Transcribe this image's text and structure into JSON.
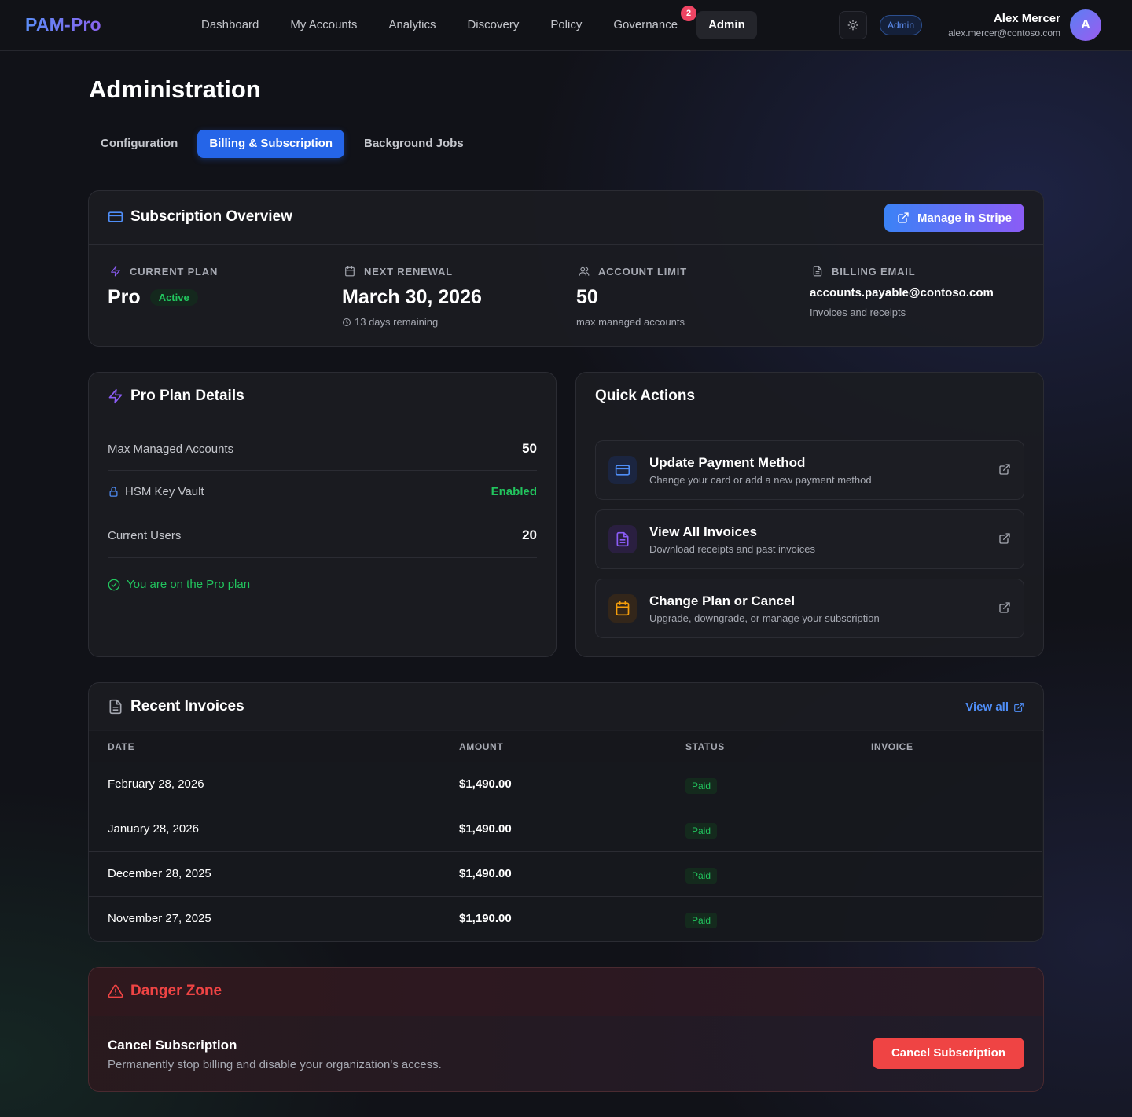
{
  "brand": "PAM-Pro",
  "nav": {
    "items": [
      "Dashboard",
      "My Accounts",
      "Analytics",
      "Discovery",
      "Policy",
      "Governance",
      "Admin"
    ],
    "governance_badge": "2",
    "active": "Admin"
  },
  "header": {
    "role_badge": "Admin",
    "user_name": "Alex Mercer",
    "user_email": "alex.mercer@contoso.com",
    "avatar_initial": "A"
  },
  "page": {
    "title": "Administration",
    "tabs": [
      "Configuration",
      "Billing & Subscription",
      "Background Jobs"
    ],
    "active_tab": "Billing & Subscription"
  },
  "overview": {
    "title": "Subscription Overview",
    "manage_button": "Manage in Stripe",
    "current_plan": {
      "label": "CURRENT PLAN",
      "value": "Pro",
      "status": "Active"
    },
    "next_renewal": {
      "label": "NEXT RENEWAL",
      "value": "March 30, 2026",
      "sub": "13 days remaining"
    },
    "account_limit": {
      "label": "ACCOUNT LIMIT",
      "value": "50",
      "sub": "max managed accounts"
    },
    "billing_email": {
      "label": "BILLING EMAIL",
      "value": "accounts.payable@contoso.com",
      "sub": "Invoices and receipts"
    }
  },
  "plan_details": {
    "title": "Pro Plan Details",
    "rows": [
      {
        "label": "Max Managed Accounts",
        "value": "50"
      },
      {
        "label": "HSM Key Vault",
        "value": "Enabled"
      },
      {
        "label": "Current Users",
        "value": "20"
      }
    ],
    "note": "You are on the Pro plan"
  },
  "quick_actions": {
    "title": "Quick Actions",
    "items": [
      {
        "title": "Update Payment Method",
        "subtitle": "Change your card or add a new payment method",
        "icon": "credit-card-icon"
      },
      {
        "title": "View All Invoices",
        "subtitle": "Download receipts and past invoices",
        "icon": "document-icon"
      },
      {
        "title": "Change Plan or Cancel",
        "subtitle": "Upgrade, downgrade, or manage your subscription",
        "icon": "calendar-icon"
      }
    ]
  },
  "invoices": {
    "title": "Recent Invoices",
    "view_all": "View all",
    "columns": [
      "DATE",
      "AMOUNT",
      "STATUS",
      "INVOICE"
    ],
    "rows": [
      {
        "date": "February 28, 2026",
        "amount": "$1,490.00",
        "status": "Paid"
      },
      {
        "date": "January 28, 2026",
        "amount": "$1,490.00",
        "status": "Paid"
      },
      {
        "date": "December 28, 2025",
        "amount": "$1,490.00",
        "status": "Paid"
      },
      {
        "date": "November 27, 2025",
        "amount": "$1,190.00",
        "status": "Paid"
      }
    ]
  },
  "danger": {
    "title": "Danger Zone",
    "heading": "Cancel Subscription",
    "description": "Permanently stop billing and disable your organization's access.",
    "button": "Cancel Subscription"
  },
  "colors": {
    "accent": "#2565e8",
    "success": "#22c55e",
    "danger": "#ef4444",
    "badge": "#ef4463"
  }
}
